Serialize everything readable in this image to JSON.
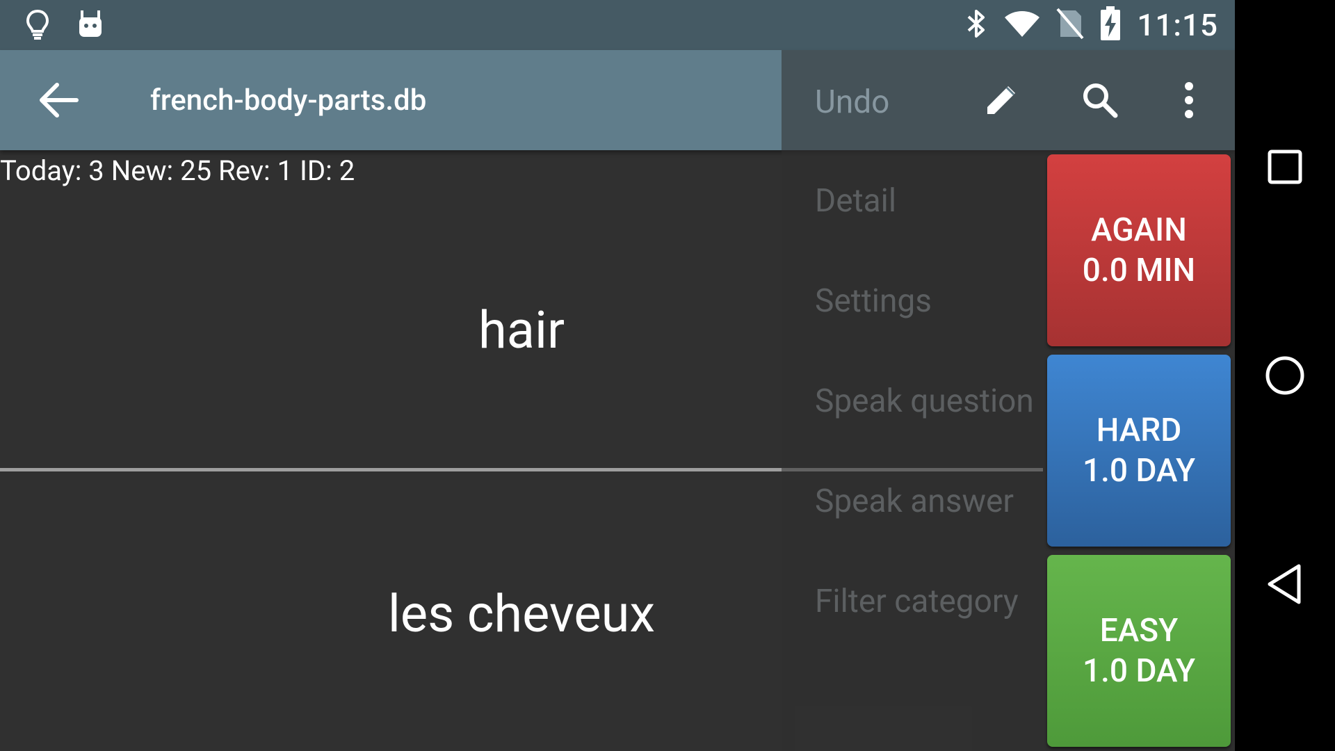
{
  "status_bar": {
    "time": "11:15",
    "left_icons": [
      "lightbulb-icon",
      "android-debug-icon"
    ],
    "right_icons": [
      "bluetooth-icon",
      "wifi-icon",
      "no-sim-icon",
      "battery-charging-icon"
    ]
  },
  "app_bar": {
    "title": "french-body-parts.db",
    "undo_label": "Undo",
    "icons": [
      "back-arrow-icon",
      "pencil-icon",
      "search-icon",
      "more-vert-icon"
    ]
  },
  "counts": "Today: 3 New: 25 Rev: 1 ID: 2",
  "card": {
    "question": "hair",
    "answer": "les cheveux"
  },
  "overflow_menu": {
    "items": [
      "Detail",
      "Settings",
      "Speak question",
      "Speak answer",
      "Filter category"
    ]
  },
  "grade_buttons": {
    "again": {
      "label": "AGAIN",
      "interval": "0.0 MIN",
      "color": "#c43a3a"
    },
    "hard": {
      "label": "HARD",
      "interval": "1.0 DAY",
      "color": "#3472b5"
    },
    "easy": {
      "label": "EASY",
      "interval": "1.0 DAY",
      "color": "#5aa842"
    }
  },
  "colors": {
    "status_bar": "#455a64",
    "app_bar": "#607d8b",
    "background": "#303030"
  }
}
